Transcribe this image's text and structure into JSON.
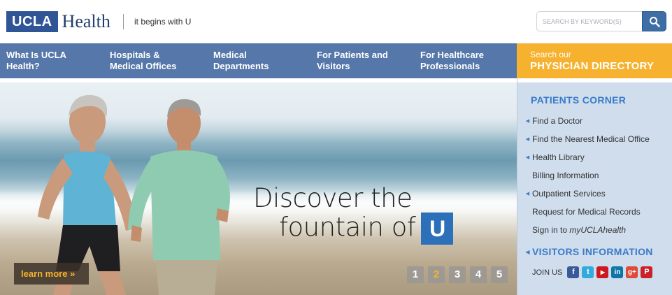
{
  "header": {
    "logo_ucla": "UCLA",
    "logo_health": "Health",
    "tagline": "it begins with U",
    "search_placeholder": "SEARCH BY KEYWORD(S)",
    "search_icon": "search-icon"
  },
  "nav": {
    "items": [
      {
        "line1": "What Is UCLA",
        "line2": "Health?"
      },
      {
        "line1": "Hospitals &",
        "line2": "Medical Offices"
      },
      {
        "line1": "Medical",
        "line2": "Departments"
      },
      {
        "line1": "For Patients and",
        "line2": "Visitors"
      },
      {
        "line1": "For Healthcare",
        "line2": "Professionals"
      }
    ],
    "directory_small": "Search our",
    "directory_big": "PHYSICIAN DIRECTORY"
  },
  "hero": {
    "headline_line1": "Discover the",
    "headline_line2": "fountain of",
    "headline_u": "U",
    "learn_more": "learn more »",
    "pages": [
      "1",
      "2",
      "3",
      "4",
      "5"
    ],
    "active_page": "2"
  },
  "sidebar": {
    "title": "PATIENTS CORNER",
    "items": [
      {
        "label": "Find a Doctor",
        "arrow": true
      },
      {
        "label": "Find the Nearest Medical Office",
        "arrow": true
      },
      {
        "label": "Health Library",
        "arrow": true
      },
      {
        "label": "Billing Information",
        "arrow": false
      },
      {
        "label": "Outpatient Services",
        "arrow": true
      },
      {
        "label": "Request for Medical Records",
        "arrow": false
      },
      {
        "label": "Sign in to ",
        "italic": "myUCLAhealth",
        "arrow": false
      }
    ],
    "visitors": "VISITORS INFORMATION",
    "join_us": "JOIN US",
    "social": [
      {
        "name": "facebook-icon",
        "glyph": "f",
        "color": "#3b5998"
      },
      {
        "name": "twitter-icon",
        "glyph": "t",
        "color": "#33aadd"
      },
      {
        "name": "youtube-icon",
        "glyph": "▶",
        "color": "#cc181e"
      },
      {
        "name": "linkedin-icon",
        "glyph": "in",
        "color": "#0e76a8"
      },
      {
        "name": "googleplus-icon",
        "glyph": "g+",
        "color": "#dd4b39"
      },
      {
        "name": "pinterest-icon",
        "glyph": "P",
        "color": "#cb2027"
      }
    ]
  },
  "colors": {
    "nav_blue": "#5577a9",
    "directory_gold": "#f6b22e",
    "brand_blue": "#2f5597",
    "sidebar_bg": "#cfdded",
    "link_blue": "#3a7bc8"
  }
}
